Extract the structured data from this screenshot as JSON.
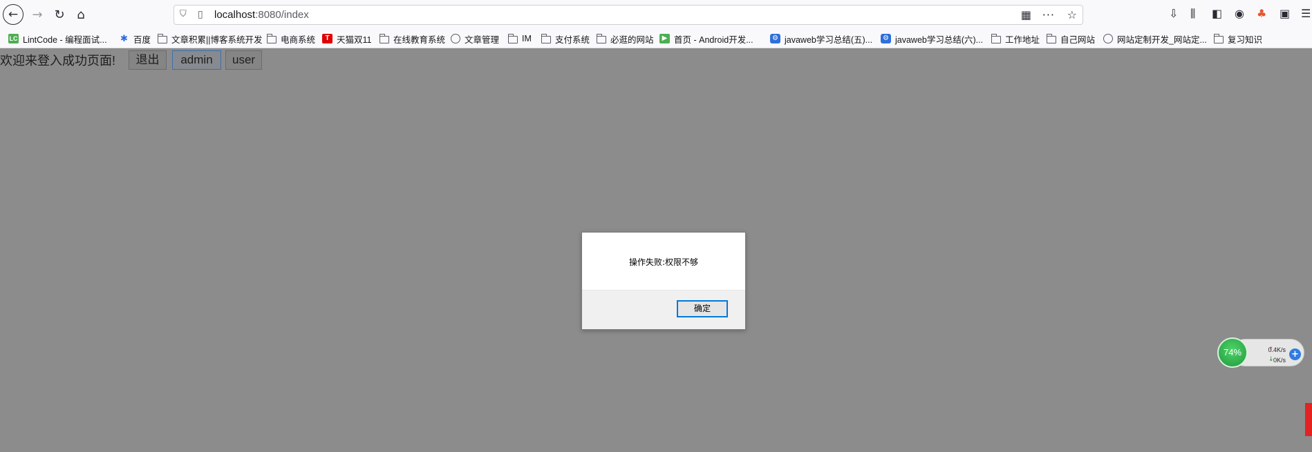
{
  "toolbar": {
    "back": "←",
    "forward": "→",
    "reload": "↻",
    "home": "⌂",
    "url_host": "localhost",
    "url_path": ":8080/index",
    "more": "···",
    "star": "☆"
  },
  "bookmarks": [
    {
      "label": "LintCode - 编程面试...",
      "icon": "lc-icon",
      "glyph": "LC"
    },
    {
      "label": "百度",
      "icon": "baidu-icon",
      "glyph": "✱"
    },
    {
      "label": "文章积累||博客系统开发",
      "icon": "folder-icon",
      "glyph": ""
    },
    {
      "label": "电商系统",
      "icon": "folder-icon",
      "glyph": ""
    },
    {
      "label": "天猫双11",
      "icon": "tmall-icon",
      "glyph": "T"
    },
    {
      "label": "在线教育系统",
      "icon": "folder-icon",
      "glyph": ""
    },
    {
      "label": "文章管理",
      "icon": "globe-icon",
      "glyph": ""
    },
    {
      "label": "IM",
      "icon": "folder-icon",
      "glyph": ""
    },
    {
      "label": "支付系统",
      "icon": "folder-icon",
      "glyph": ""
    },
    {
      "label": "必逛的网站",
      "icon": "folder-icon",
      "glyph": ""
    },
    {
      "label": "首页 - Android开发...",
      "icon": "android-icon",
      "glyph": "▶"
    },
    {
      "label": "javaweb学习总结(五)...",
      "icon": "gear-icon",
      "glyph": "⚙"
    },
    {
      "label": "javaweb学习总结(六)...",
      "icon": "gear-icon",
      "glyph": "⚙"
    },
    {
      "label": "工作地址",
      "icon": "folder-icon",
      "glyph": ""
    },
    {
      "label": "自己网站",
      "icon": "folder-icon",
      "glyph": ""
    },
    {
      "label": "网站定制开发_网站定...",
      "icon": "globe-icon",
      "glyph": ""
    },
    {
      "label": "复习知识",
      "icon": "folder-icon",
      "glyph": ""
    }
  ],
  "page": {
    "welcome": "欢迎来登入成功页面!",
    "logout_label": "退出",
    "admin_label": "admin",
    "user_label": "user"
  },
  "dialog": {
    "message": "操作失败:权限不够",
    "ok_label": "确定"
  },
  "speed_widget": {
    "percent": "74%",
    "upload": "0.4K/s",
    "download": "0K/s",
    "up_arrow": "↑",
    "down_arrow": "↓",
    "plus": "+"
  },
  "colors": {
    "page_background": "#8c8c8c",
    "dialog_button_border": "#0078d7",
    "speed_green": "#2fb34e"
  }
}
